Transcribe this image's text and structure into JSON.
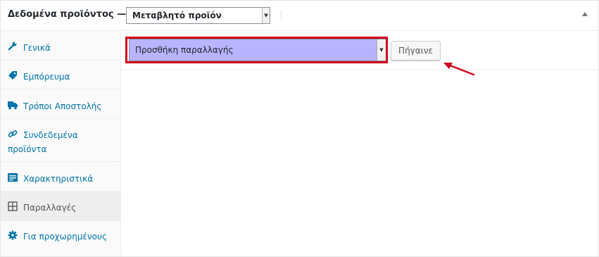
{
  "header": {
    "title": "Δεδομένα προϊόντος —",
    "product_type": "Μεταβλητό προϊόν",
    "collapse_icon": "triangle-up-icon"
  },
  "sidebar": {
    "items": [
      {
        "label": "Γενικά",
        "icon": "wrench-icon"
      },
      {
        "label": "Εμπόρευμα",
        "icon": "tag-icon"
      },
      {
        "label": "Τρόποι Αποστολής",
        "icon": "truck-icon"
      },
      {
        "label_line1": "Συνδεδεμένα",
        "label_line2": "προϊόντα",
        "icon": "link-icon"
      },
      {
        "label": "Χαρακτηριστικά",
        "icon": "list-card-icon"
      },
      {
        "label": "Παραλλαγές",
        "icon": "grid-icon",
        "active": true
      },
      {
        "label": "Για προχωρημένους",
        "icon": "gear-icon"
      }
    ]
  },
  "variations": {
    "action_select": "Προσθήκη παραλλαγής",
    "go_label": "Πήγαινε"
  },
  "colors": {
    "highlight": "#d0021b",
    "link": "#0073aa",
    "select_bg": "#b8b4ff"
  }
}
